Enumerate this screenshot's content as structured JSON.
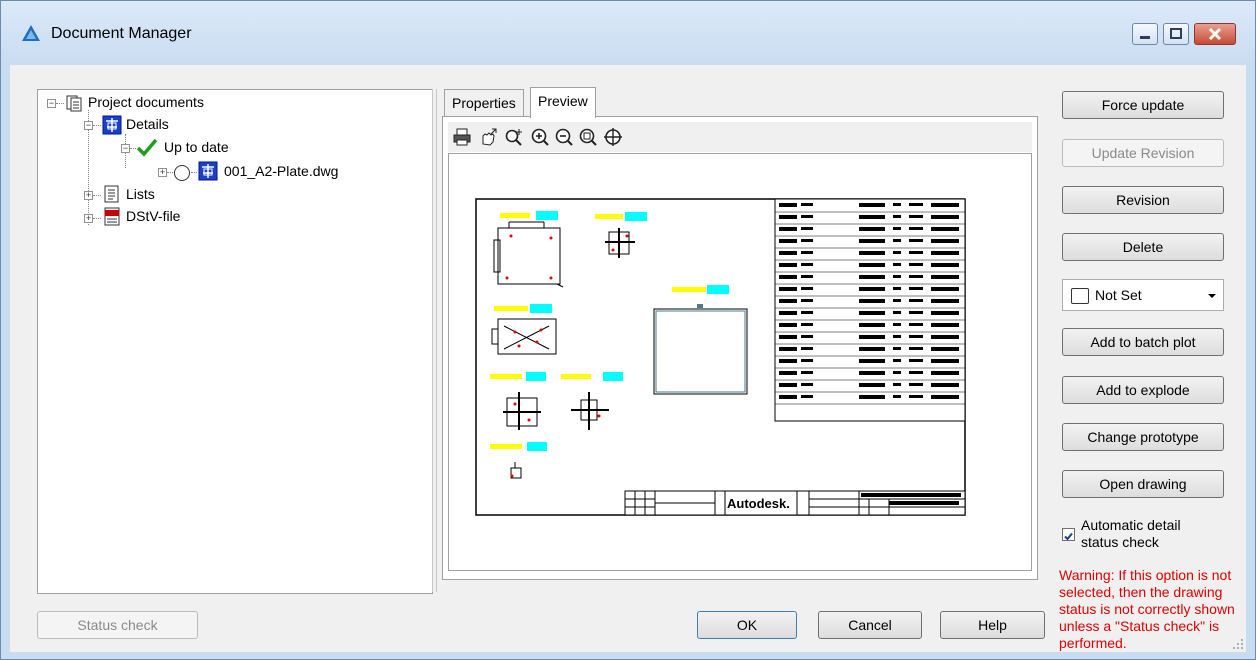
{
  "window": {
    "title": "Document Manager"
  },
  "tree": {
    "root": "Project documents",
    "details": "Details",
    "up_to_date": "Up to date",
    "file": "001_A2-Plate.dwg",
    "lists": "Lists",
    "dstv": "DStV-file"
  },
  "tabs": [
    {
      "label": "Properties"
    },
    {
      "label": "Preview"
    }
  ],
  "drawing": {
    "logo_text": "Autodesk."
  },
  "buttons": {
    "force_update": "Force update",
    "update_revision": "Update Revision",
    "revision": "Revision",
    "delete": "Delete",
    "add_batch": "Add to batch plot",
    "add_explode": "Add to explode",
    "change_prototype": "Change prototype",
    "open_drawing": "Open drawing",
    "status_check": "Status check",
    "ok": "OK",
    "cancel": "Cancel",
    "help": "Help"
  },
  "status_select": {
    "value": "Not Set"
  },
  "auto_check": {
    "label": "Automatic detail status check",
    "checked": true
  },
  "warning": "Warning: If this option is not selected, then the drawing status is not correctly shown unless a \"Status check\" is performed.",
  "colors": {
    "warning": "#e00000",
    "title_bar": "#c9dcf2",
    "yellow_label": "#ffff00",
    "cyan_label": "#00ffff"
  }
}
